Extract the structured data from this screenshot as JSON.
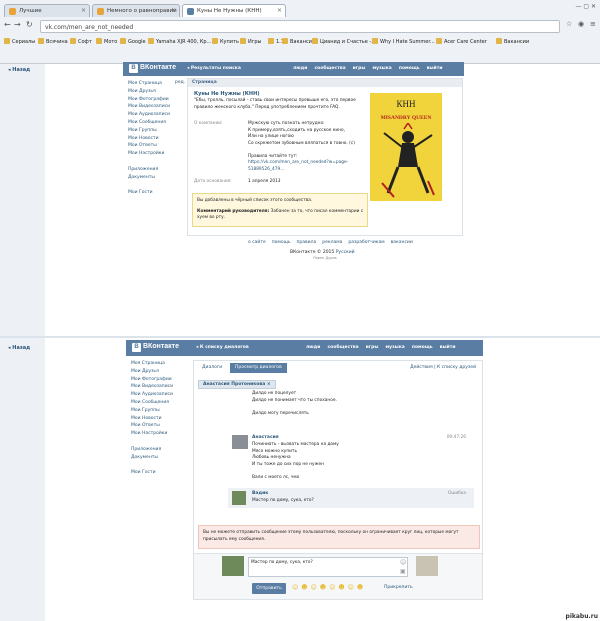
{
  "browser": {
    "tabs": [
      {
        "label": "Лучшие"
      },
      {
        "label": "Немного о равноправии"
      },
      {
        "label": "Куны Не Нужны (КНН)"
      }
    ],
    "address": "vk.com/men_are_not_needed",
    "bookmarks": [
      "Сериалы",
      "Всячина",
      "Софт",
      "Мото",
      "Google",
      "Yamaha XJR 400, Кр...",
      "Купить",
      "Игры",
      "1.12",
      "Вакансии",
      "Цианид и Счастье -...",
      "Why I Hate Summer...",
      "Acer Care Center",
      "Вакансии"
    ]
  },
  "top": {
    "back": "Назад",
    "header": {
      "logo": "ВКонтакте",
      "search": "Результаты поиска",
      "nav": [
        "люди",
        "сообщества",
        "игры",
        "музыка",
        "помощь",
        "выйти"
      ]
    },
    "menu": [
      "Моя Страница",
      "Мои Друзья",
      "Мои Фотографии",
      "Мои Видеозаписи",
      "Мои Аудиозаписи",
      "Мои Сообщения",
      "Мои Группы",
      "Мои Новости",
      "Мои Ответы",
      "Мои Настройки",
      "",
      "Приложения",
      "Документы",
      "",
      "Мои Гости"
    ],
    "menu_edit": "ред.",
    "page_label": "Страница",
    "group_name": "Куны Не Нужны (КНН)",
    "status": [
      "\"Ебы, тролль, посылай - ставь свои интересы превыше его, это первое",
      "правило женского клуба.\" Перед употреблением прочтите FAQ."
    ],
    "about_label": "О компании:",
    "about_lines": [
      "Мужскую суть познать нетрудно:",
      "К примеру,взять,сходить на русское кино,",
      "Или на улице ногою",
      "Со скрежетом зубовным вляпаться в говно. (с)",
      "",
      "Правила читайте тут:",
      "https://vk.com/men_are_not_needed?w=page-",
      "51889526_479..."
    ],
    "founded_label": "Дата основания:",
    "founded_value": "1 апреля 2013",
    "blacklist_line1": "Вы добавлены в чёрный список этого сообщества.",
    "blacklist_comment_label": "Комментарий руководителя:",
    "blacklist_comment": "Забанен за то, что писал комментарии с",
    "blacklist_comment2": "хуем во рту.",
    "cover_title": "КНН",
    "cover_subtitle": "MISANDRY QUEEN",
    "footer_links": [
      "о сайте",
      "помощь",
      "правила",
      "реклама",
      "разработчикам",
      "вакансии"
    ],
    "footer_copy": "ВКонтакте © 2015",
    "footer_lang": "Русский",
    "footer_author": "Павел Дуров"
  },
  "bottom": {
    "back": "Назад",
    "header": {
      "logo": "ВКонтакте",
      "crumb": "К списку диалогов",
      "nav": [
        "люди",
        "сообщества",
        "игры",
        "музыка",
        "помощь",
        "выйти"
      ]
    },
    "menu": [
      "Моя Страница",
      "Мои Друзья",
      "Мои Фотографии",
      "Мои Видеозаписи",
      "Мои Аудиозаписи",
      "Мои Сообщения",
      "Мои Группы",
      "Мои Новости",
      "Мои Ответы",
      "Мои Настройки",
      "",
      "Приложения",
      "Документы",
      "",
      "Мои Гости"
    ],
    "tabs": [
      "Диалоги",
      "Просмотр диалогов"
    ],
    "right_links": "Действия | К списку друзей",
    "chip": "Анастасия Протоникова",
    "chat_top_lines": [
      "Дилдо не поцелует",
      "Дилдо не понимает что ты споханое.",
      "",
      "Дилдо могу перечислять"
    ],
    "msg1": {
      "author": "Анастасия",
      "time": "09:47:26",
      "lines": [
        "Починиать - вызвать мастера на дому",
        "Мясо можно купить",
        "Любовь ненужна",
        "И ты тоже до сих пор не нужен",
        "",
        "Вали с моего лс, чмо"
      ]
    },
    "msg2": {
      "author": "Вадик",
      "status": "Ошибка",
      "text": "Мастер по дому, сука, кто?"
    },
    "error": "Вы не можете отправить сообщение этому пользователю, поскольку он ограничивает круг лиц, которые могут",
    "error2": "присылать ему сообщения.",
    "input_value": "Мастер по дому, сука, кто?",
    "send": "Отправить",
    "attach": "Прикрепить",
    "emoji": [
      "☺",
      "☻",
      "☺",
      "☻",
      "☺",
      "☻",
      "☺",
      "☻"
    ]
  },
  "watermark": "pikabu.ru"
}
